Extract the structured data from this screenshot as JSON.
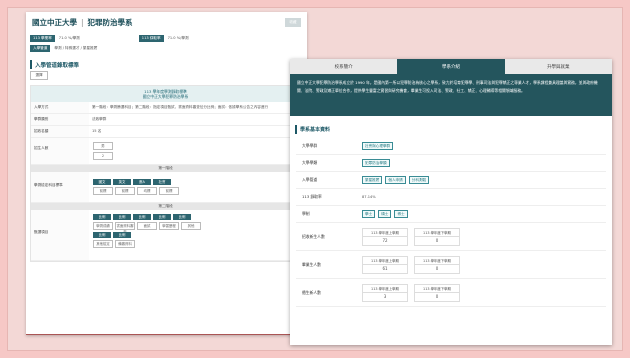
{
  "left": {
    "school": "國立中正大學",
    "dept": "犯罪防治學系",
    "top_btn": "收藏",
    "info": [
      {
        "tag": "113 學業率",
        "val": "71.0 %/學測",
        "tag2": "113 錄取率",
        "val2": "71.0 %/學測"
      },
      {
        "tag": "入學管道",
        "val": "學測 / 特殊選才 / 繁星推薦"
      }
    ],
    "section_title": "入學管道錄取標準",
    "section_btn": "選擇",
    "teal_head_1": "113 學年度學測錄取標準",
    "teal_head_2": "國立中正大學犯罪防治學系",
    "rows": [
      {
        "label": "入學方式",
        "text": "第一階段：學測篩選科目；第二階段：指定項目甄試，書面資料審查佔分比例；面試：依據學系公告之內容進行"
      },
      {
        "label": "學群類別",
        "text": "法政學群"
      },
      {
        "label": "招收名額",
        "text": "15 名"
      }
    ],
    "gender_label": "招生人數",
    "gender_head": "男",
    "gender_val": "2",
    "band1": "第一階段",
    "band1_label": "學測檢定科目標準",
    "band1_heads": [
      "國文",
      "英文",
      "數A",
      "社會"
    ],
    "band1_vals": [
      "前標",
      "前標",
      "均標",
      "前標"
    ],
    "band2": "第二階段",
    "band2_label": "甄選項目",
    "band2_heads": [
      "比例",
      "比例",
      "比例",
      "比例",
      "比例"
    ],
    "band2_vals": [
      "學測成績",
      "書面資料審查",
      "面試",
      "學習歷程",
      "其他"
    ],
    "band2_row2": [
      "比例",
      "比例"
    ],
    "band2_row2_vals": [
      "其他檢定",
      "備審資料"
    ]
  },
  "right": {
    "tabs": [
      "校系簡介",
      "學系介紹",
      "升學與就業"
    ],
    "description": "國立中正大學犯罪防治學系成立於 1990 年，是國內第一所以犯罪防治為核心之學系，致力於培育犯罪學、刑事司法與犯罪矯正之專業人才，學系課程兼具理論與實務，並與政府機關、法院、警政及矯正單位合作，提供學生豐富之實習與研究機會，畢業生可投入司法、警政、社工、矯正、心理輔導等相關領域服務。",
    "section_title": "學系基本資料",
    "rows": {
      "college_label": "大學學群",
      "college_chips": [
        "社會與心理學群"
      ],
      "category_label": "大學學類",
      "category_chips": [
        "犯罪防治學類"
      ],
      "admission_label": "入學管道",
      "admission_chips": [
        "繁星推薦",
        "個人申請",
        "分科測驗"
      ],
      "rate_label": "113 錄取率",
      "rate_val": "87.14%",
      "degree_label": "學制",
      "degree_chips": [
        "學士",
        "碩士",
        "博士"
      ],
      "enroll_label": "招收新生人數",
      "enroll_heads": [
        "113 學年度上學期",
        "113 學年度下學期"
      ],
      "enroll_vals": [
        "72",
        "0"
      ],
      "grad_label": "畢業生人數",
      "grad_heads": [
        "113 學年度上學期",
        "113 學年度下學期"
      ],
      "grad_vals": [
        "61",
        "0"
      ],
      "intl_label": "僑生新人數",
      "intl_heads": [
        "113 學年度上學期",
        "113 學年度下學期"
      ],
      "intl_vals": [
        "3",
        "0"
      ]
    }
  }
}
